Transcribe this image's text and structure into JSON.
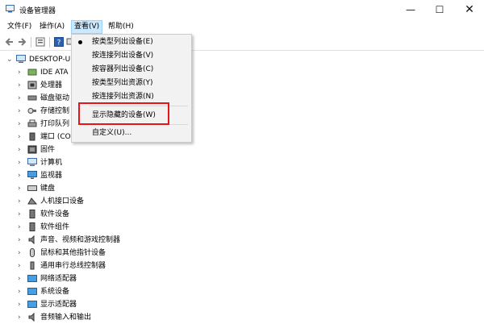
{
  "window": {
    "title": "设备管理器",
    "controls": {
      "minimize": "—",
      "maximize": "☐",
      "close": "✕"
    }
  },
  "menubar": {
    "file": "文件(F)",
    "action": "操作(A)",
    "view": "查看(V)",
    "help": "帮助(H)"
  },
  "toolbar": {
    "icons": [
      "back-icon",
      "forward-icon",
      "properties-icon",
      "help-icon",
      "device-icon"
    ]
  },
  "tree": {
    "root": "DESKTOP-U",
    "items": [
      "IDE ATA",
      "处理器",
      "磁盘驱动",
      "存储控制",
      "打印队列",
      "端口 (CO",
      "固件",
      "计算机",
      "监视器",
      "键盘",
      "人机接口设备",
      "软件设备",
      "软件组件",
      "声音、视频和游戏控制器",
      "鼠标和其他指针设备",
      "通用串行总线控制器",
      "网络适配器",
      "系统设备",
      "显示适配器",
      "音频输入和输出"
    ]
  },
  "view_menu": {
    "items": [
      "按类型列出设备(E)",
      "按连接列出设备(V)",
      "按容器列出设备(C)",
      "按类型列出资源(Y)",
      "按连接列出资源(N)",
      "显示隐藏的设备(W)",
      "自定义(U)..."
    ],
    "checked_index": 0,
    "highlighted_index": 5
  },
  "colors": {
    "highlight_border": "#e8131b",
    "menu_active_bg": "#cce8ff",
    "dropdown_bg": "#f2f2f2"
  }
}
